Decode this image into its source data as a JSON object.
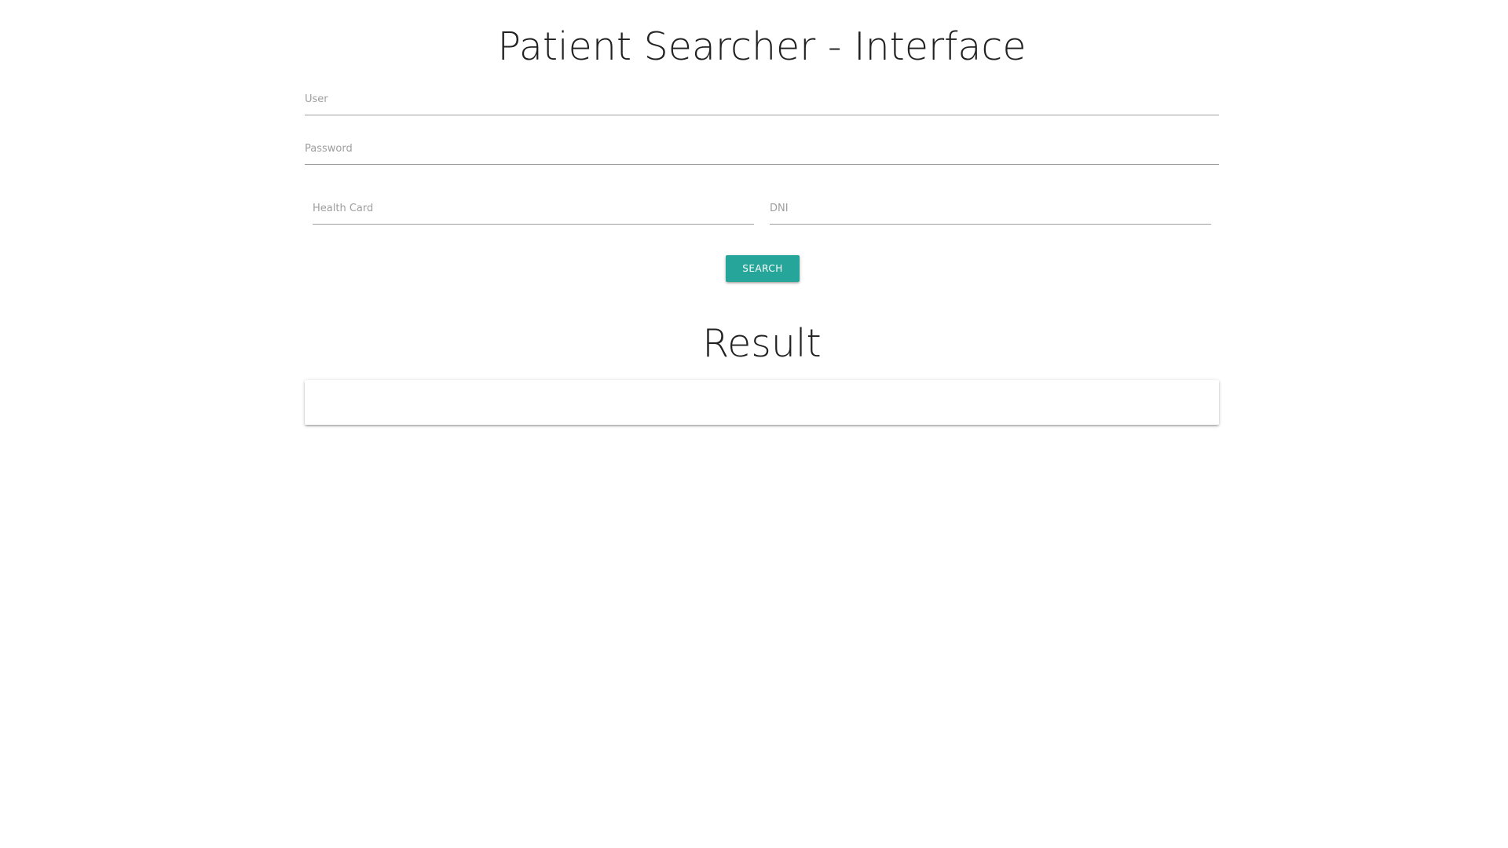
{
  "header": {
    "title": "Patient Searcher - Interface"
  },
  "login": {
    "user_placeholder": "User",
    "user_value": "",
    "password_placeholder": "Password",
    "password_value": ""
  },
  "search": {
    "health_card_placeholder": "Health Card",
    "health_card_value": "",
    "dni_placeholder": "DNI",
    "dni_value": "",
    "button_label": "SEARCH"
  },
  "result": {
    "title": "Result",
    "content": ""
  },
  "colors": {
    "accent": "#26a69a",
    "text": "#212121",
    "placeholder": "#9e9e9e",
    "underline": "#9e9e9e"
  }
}
